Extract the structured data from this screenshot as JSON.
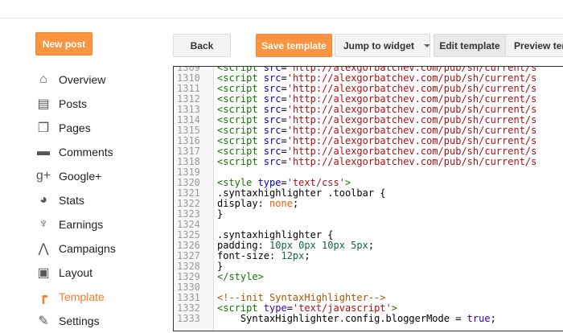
{
  "toolbar": {
    "new_post": "New post",
    "back": "Back",
    "save": "Save template",
    "jump": "Jump to widget",
    "edit": "Edit template",
    "preview": "Preview template"
  },
  "sidebar": {
    "items": [
      {
        "label": "Overview",
        "icon": "home-icon"
      },
      {
        "label": "Posts",
        "icon": "posts-icon"
      },
      {
        "label": "Pages",
        "icon": "pages-icon"
      },
      {
        "label": "Comments",
        "icon": "comment-icon"
      },
      {
        "label": "Google+",
        "icon": "google-plus-icon"
      },
      {
        "label": "Stats",
        "icon": "pie-chart-icon"
      },
      {
        "label": "Earnings",
        "icon": "trophy-icon"
      },
      {
        "label": "Campaigns",
        "icon": "adwords-icon"
      },
      {
        "label": "Layout",
        "icon": "layout-icon"
      },
      {
        "label": "Template",
        "icon": "paint-roller-icon",
        "active": true
      },
      {
        "label": "Settings",
        "icon": "wrench-icon"
      }
    ]
  },
  "colors": {
    "accent": "#f57d2c",
    "button_orange": "#fa9440"
  },
  "editor": {
    "lines": [
      {
        "n": "1309",
        "t": "script",
        "url": "'http://alexgorbatchev.com/pub/sh/current/s"
      },
      {
        "n": "1310",
        "t": "script",
        "url": "'http://alexgorbatchev.com/pub/sh/current/s"
      },
      {
        "n": "1311",
        "t": "script",
        "url": "'http://alexgorbatchev.com/pub/sh/current/s"
      },
      {
        "n": "1312",
        "t": "script",
        "url": "'http://alexgorbatchev.com/pub/sh/current/s"
      },
      {
        "n": "1313",
        "t": "script",
        "url": "'http://alexgorbatchev.com/pub/sh/current/s"
      },
      {
        "n": "1314",
        "t": "script",
        "url": "'http://alexgorbatchev.com/pub/sh/current/s"
      },
      {
        "n": "1315",
        "t": "script",
        "url": "'http://alexgorbatchev.com/pub/sh/current/s"
      },
      {
        "n": "1316",
        "t": "script",
        "url": "'http://alexgorbatchev.com/pub/sh/current/s"
      },
      {
        "n": "1317",
        "t": "script",
        "url": "'http://alexgorbatchev.com/pub/sh/current/s"
      },
      {
        "n": "1318",
        "t": "script",
        "url": "'http://alexgorbatchev.com/pub/sh/current/s"
      },
      {
        "n": "1319",
        "parts": []
      },
      {
        "n": "1320",
        "parts": [
          [
            "tag",
            "<style "
          ],
          [
            "attr",
            "type"
          ],
          [
            "",
            "="
          ],
          [
            "str",
            "'text/css'"
          ],
          [
            "tag",
            ">"
          ]
        ]
      },
      {
        "n": "1321",
        "parts": [
          [
            "",
            ".syntaxhighlighter .toolbar {"
          ]
        ]
      },
      {
        "n": "1322",
        "parts": [
          [
            "",
            "display: "
          ],
          [
            "kw",
            "none"
          ],
          [
            "",
            ";"
          ]
        ]
      },
      {
        "n": "1323",
        "parts": [
          [
            "",
            "}"
          ]
        ]
      },
      {
        "n": "1324",
        "parts": []
      },
      {
        "n": "1325",
        "parts": [
          [
            "",
            ".syntaxhighlighter {"
          ]
        ]
      },
      {
        "n": "1326",
        "parts": [
          [
            "",
            "padding: "
          ],
          [
            "num",
            "10px 0px 10px 5px"
          ],
          [
            "",
            ";"
          ]
        ]
      },
      {
        "n": "1327",
        "parts": [
          [
            "",
            "font-size: "
          ],
          [
            "num",
            "12px"
          ],
          [
            "",
            ";"
          ]
        ]
      },
      {
        "n": "1328",
        "parts": [
          [
            "",
            "}"
          ]
        ]
      },
      {
        "n": "1329",
        "parts": [
          [
            "tag",
            "</style>"
          ]
        ]
      },
      {
        "n": "1330",
        "parts": []
      },
      {
        "n": "1331",
        "parts": [
          [
            "cm",
            "<!--init SyntaxHighlighter-->"
          ]
        ]
      },
      {
        "n": "1332",
        "parts": [
          [
            "tag",
            "<script "
          ],
          [
            "blue",
            "type"
          ],
          [
            "",
            "="
          ],
          [
            "str",
            "'text/javascript'"
          ],
          [
            "tag",
            ">"
          ]
        ]
      },
      {
        "n": "1333",
        "parts": [
          [
            "",
            "    SyntaxHighlighter.config.bloggerMode = "
          ],
          [
            "blue",
            "true"
          ],
          [
            "",
            ";"
          ]
        ]
      }
    ]
  }
}
